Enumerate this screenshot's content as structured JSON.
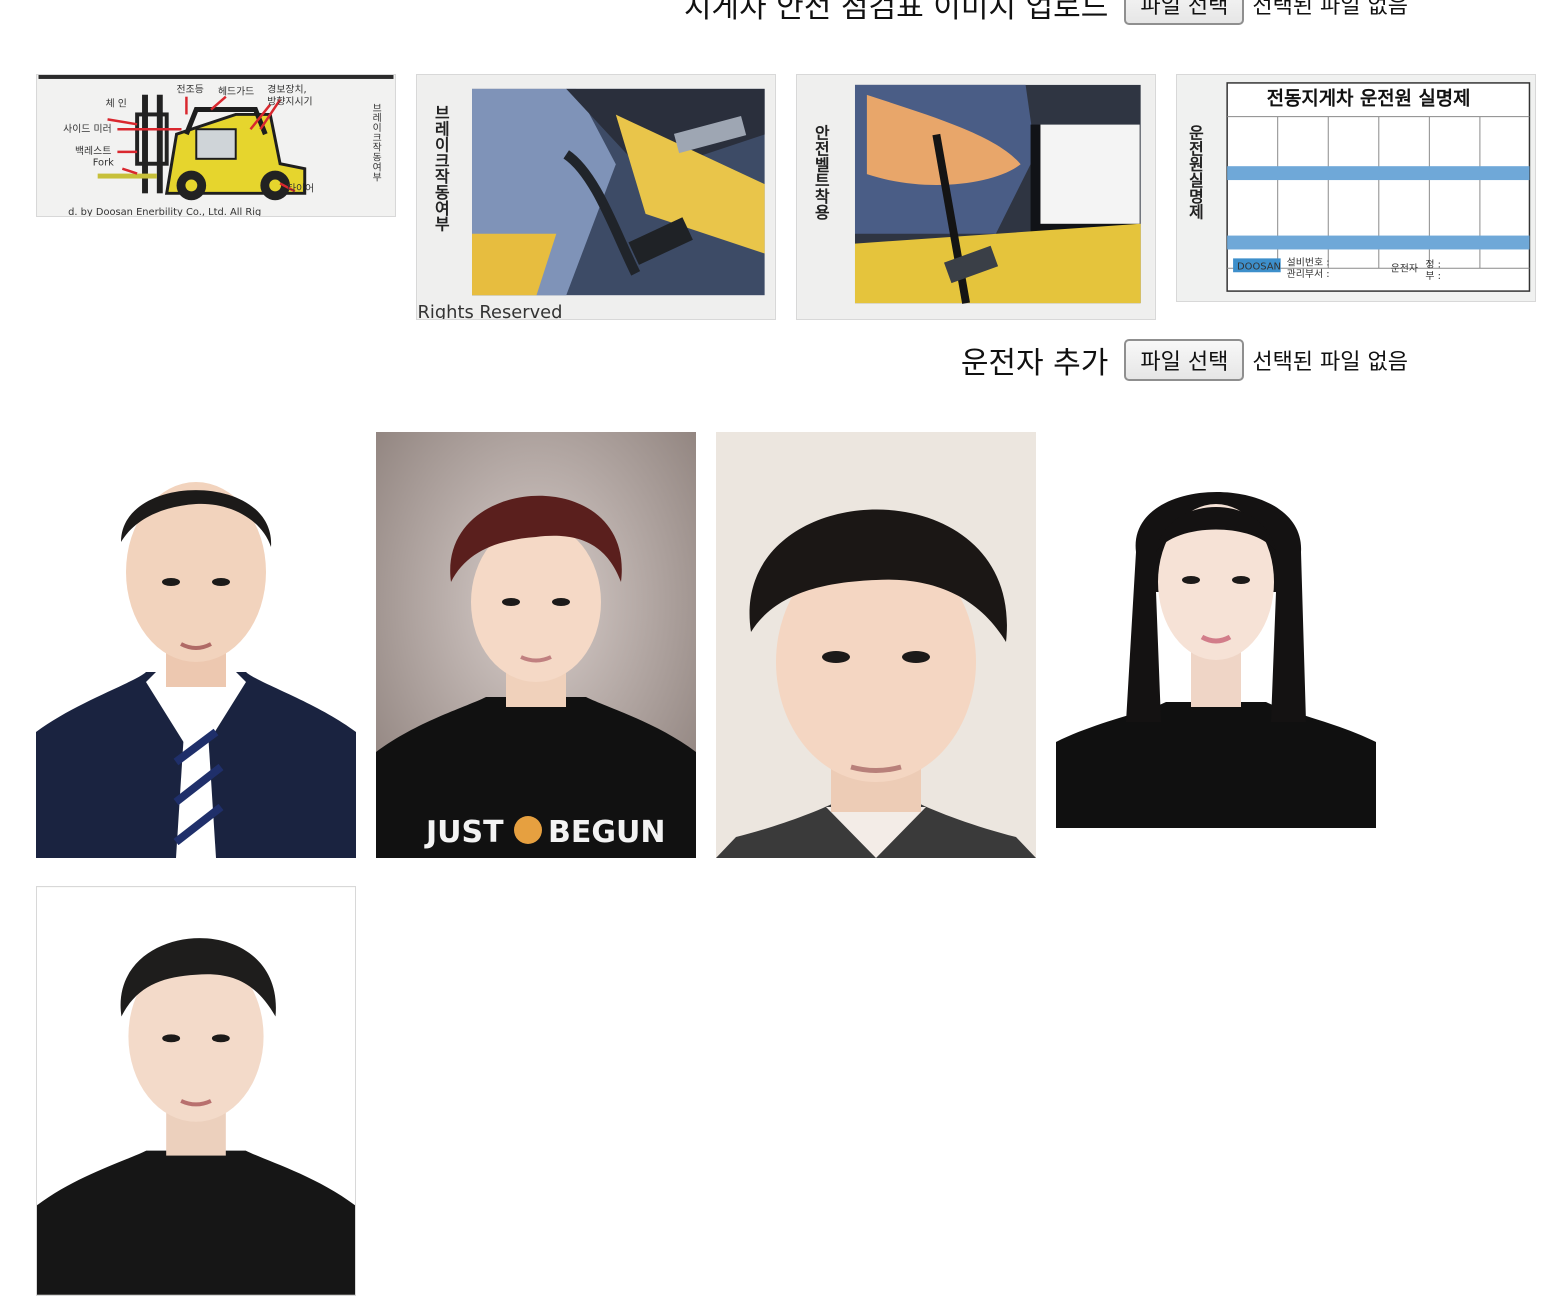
{
  "checklist_upload": {
    "label": "지게차 안전 점검표 이미지 업로드",
    "button_label": "파일 선택",
    "status": "선택된 파일 없음"
  },
  "checklist_images": [
    {
      "kind": "forklift-diagram",
      "labels": [
        "전조등",
        "헤드가드",
        "경보장치,",
        "방향지시기",
        "체 인",
        "사이드 미러",
        "백레스트",
        "Fork",
        "타이어",
        "브레이크작동여부"
      ],
      "caption": "d.  by Doosan Enerbility Co., Ltd. All Rig"
    },
    {
      "kind": "brake-photo",
      "vertical_label": "브레이크작동여부",
      "caption": "Rights Reserved"
    },
    {
      "kind": "seatbelt-photo",
      "vertical_label": "안전벨트착용"
    },
    {
      "kind": "driver-sheet",
      "title": "전동지게차 운전원 실명제",
      "vertical_label": "운전원실명제",
      "brand": "DOOSAN",
      "fields": [
        "설비번호 :",
        "관리부서 :",
        "운전자",
        "정 :",
        "부 :"
      ]
    }
  ],
  "driver_upload": {
    "label": "운전자 추가",
    "button_label": "파일 선택",
    "status": "선택된 파일 없음"
  },
  "driver_photos": [
    {
      "kind": "suit-and-tie",
      "background": "#ffffff",
      "hair": "#1c1a19",
      "clothing": "#1a2340"
    },
    {
      "kind": "black-tshirt",
      "background": "#a89a94",
      "hair": "#5a1f1d",
      "clothing": "#111111",
      "shirt_text": [
        "JUST",
        "BEGUN"
      ]
    },
    {
      "kind": "shirt-collar",
      "background": "#ece6df",
      "hair": "#1b1715",
      "clothing": "#3a3a3a"
    },
    {
      "kind": "long-hair-black-top",
      "background": "#ffffff",
      "hair": "#141212",
      "clothing": "#101010"
    },
    {
      "kind": "black-sweater",
      "background": "#ffffff",
      "hair": "#1e1d1c",
      "clothing": "#161616"
    }
  ]
}
